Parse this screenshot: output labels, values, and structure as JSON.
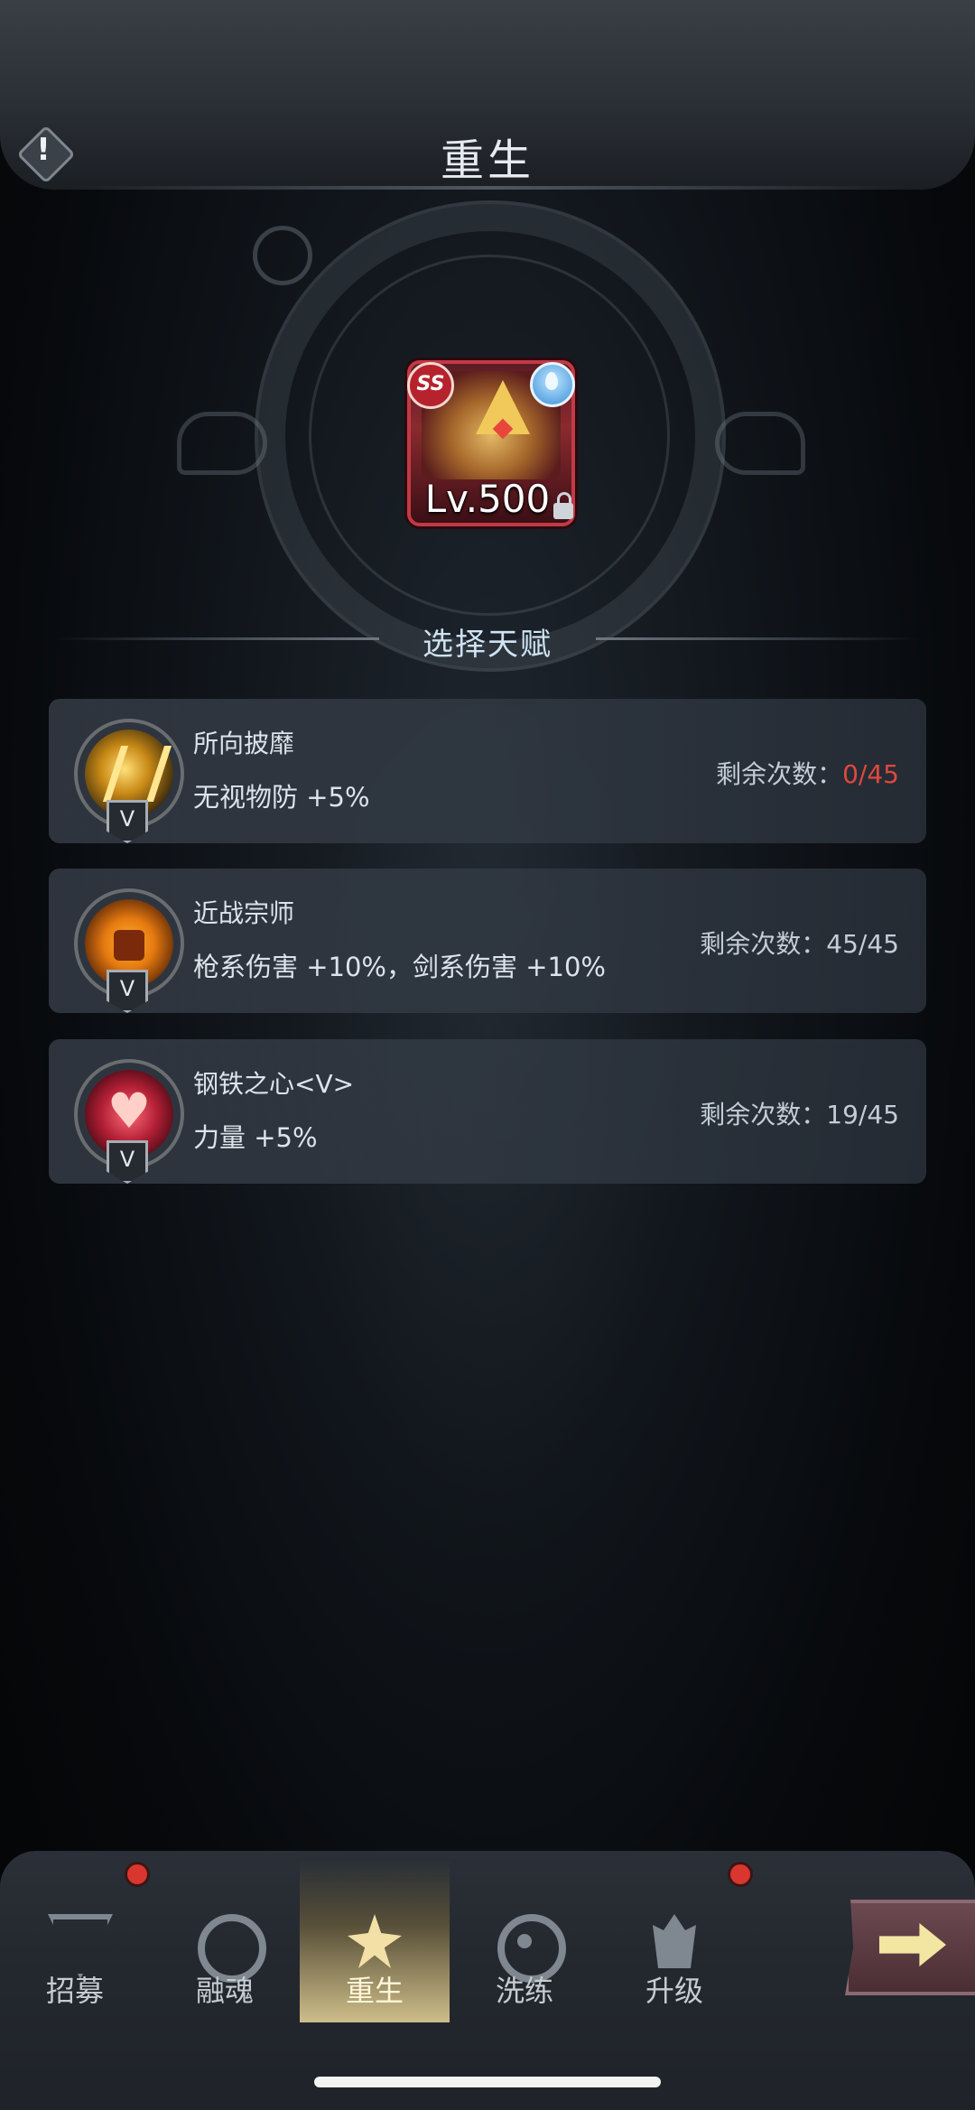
{
  "header": {
    "title": "重生"
  },
  "hero": {
    "rank": "SS",
    "level": "Lv.500"
  },
  "select_title": "选择天赋",
  "talents": [
    {
      "name": "所向披靡",
      "effect": "无视物防 +5%",
      "grade": "V",
      "remaining_label": "剩余次数：",
      "remaining_value": "0/45",
      "icon": "golden-claw-icon"
    },
    {
      "name": "近战宗师",
      "effect": "枪系伤害 +10%，剑系伤害 +10%",
      "grade": "V",
      "remaining_label": "剩余次数：",
      "remaining_value": "45/45",
      "icon": "fist-sun-icon"
    },
    {
      "name": "钢铁之心<Ⅴ>",
      "effect": "力量 +5%",
      "grade": "V",
      "remaining_label": "剩余次数：",
      "remaining_value": "19/45",
      "icon": "heart-icon"
    }
  ],
  "nav": {
    "items": [
      {
        "label": "招募",
        "icon": "recruit-icon",
        "has_notification": true
      },
      {
        "label": "融魂",
        "icon": "fuse-soul-icon",
        "has_notification": false
      },
      {
        "label": "重生",
        "icon": "rebirth-icon",
        "active": true
      },
      {
        "label": "洗练",
        "icon": "refine-icon",
        "has_notification": false
      },
      {
        "label": "升级",
        "icon": "upgrade-icon",
        "has_notification": true
      }
    ]
  },
  "colors": {
    "depleted": "#e0483e",
    "accent_gold": "#cfbe8a",
    "card_red": "#c23a46"
  }
}
